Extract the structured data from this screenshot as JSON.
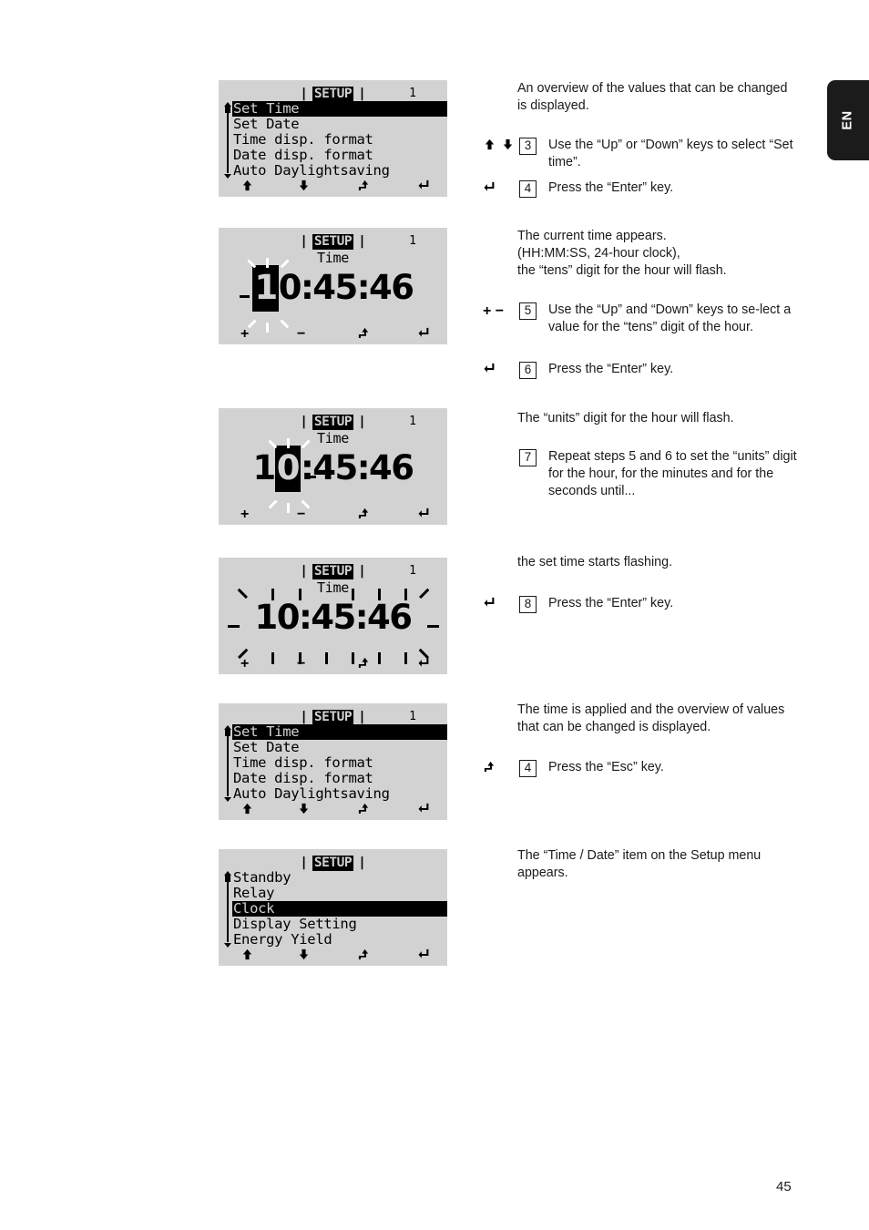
{
  "page": {
    "number": "45",
    "language_tab": "EN"
  },
  "icons": {
    "up": "▲",
    "down": "▼",
    "esc": "⬑",
    "enter": "↵",
    "plus": "+",
    "minus": "−"
  },
  "steps": [
    {
      "lcd": {
        "type": "menu",
        "header_left_pipe": "|",
        "header_title": "SETUP",
        "header_right_pipe": "|",
        "header_number": "1",
        "items": [
          "Set Time",
          "Set Date",
          "Time disp. format",
          "Date disp. format",
          "Auto Daylightsaving"
        ],
        "selected_index": 0,
        "softkeys": [
          "up",
          "down",
          "esc",
          "enter"
        ]
      },
      "paragraph": "An overview of the values that can be changed is displayed.",
      "instructions": [
        {
          "key_icon": "up-down",
          "number": "3",
          "text": "Use the “Up” or “Down” keys to select “Set time”."
        },
        {
          "key_icon": "enter",
          "number": "4",
          "text": "Press the “Enter” key."
        }
      ]
    },
    {
      "lcd": {
        "type": "time",
        "header_left_pipe": "|",
        "header_title": "SETUP",
        "header_right_pipe": "|",
        "header_number": "1",
        "subtitle": "Time",
        "time_digits": [
          "1",
          "0",
          ":",
          "4",
          "5",
          ":",
          "4",
          "6"
        ],
        "highlight_index": 0,
        "flash_scope": "digit",
        "softkeys": [
          "plus",
          "minus",
          "esc",
          "enter"
        ]
      },
      "paragraph": "The current time appears.\n(HH:MM:SS, 24-hour clock),\nthe “tens” digit for the hour will flash.",
      "instructions": [
        {
          "key_icon": "plus-minus",
          "number": "5",
          "text": "Use the “Up” and “Down” keys to se-lect a value for the “tens” digit of the hour."
        },
        {
          "key_icon": "enter",
          "number": "6",
          "text": "Press the “Enter” key."
        }
      ]
    },
    {
      "lcd": {
        "type": "time",
        "header_left_pipe": "|",
        "header_title": "SETUP",
        "header_right_pipe": "|",
        "header_number": "1",
        "subtitle": "Time",
        "time_digits": [
          "1",
          "0",
          ":",
          "4",
          "5",
          ":",
          "4",
          "6"
        ],
        "highlight_index": 1,
        "flash_scope": "digit",
        "softkeys": [
          "plus",
          "minus",
          "esc",
          "enter"
        ]
      },
      "paragraph": "The “units” digit for the hour will flash.",
      "instructions": [
        {
          "key_icon": "none",
          "number": "7",
          "text": "Repeat steps 5 and 6 to set the “units” digit for the hour, for the minutes and for the seconds until..."
        }
      ]
    },
    {
      "lcd": {
        "type": "time",
        "header_left_pipe": "|",
        "header_title": "SETUP",
        "header_right_pipe": "|",
        "header_number": "1",
        "subtitle": "Time",
        "time_digits": [
          "1",
          "0",
          ":",
          "4",
          "5",
          ":",
          "4",
          "6"
        ],
        "highlight_index": -1,
        "flash_scope": "all",
        "softkeys": [
          "plus",
          "minus",
          "esc",
          "enter"
        ]
      },
      "paragraph": "the set time starts flashing.",
      "instructions": [
        {
          "key_icon": "enter",
          "number": "8",
          "text": "Press the “Enter” key."
        }
      ]
    },
    {
      "lcd": {
        "type": "menu",
        "header_left_pipe": "|",
        "header_title": "SETUP",
        "header_right_pipe": "|",
        "header_number": "1",
        "items": [
          "Set Time",
          "Set Date",
          "Time disp. format",
          "Date disp. format",
          "Auto Daylightsaving"
        ],
        "selected_index": 0,
        "softkeys": [
          "up",
          "down",
          "esc",
          "enter"
        ]
      },
      "paragraph": "The time is applied and the overview of values that can be changed is displayed.",
      "instructions": [
        {
          "key_icon": "esc",
          "number": "4",
          "text": "Press the “Esc” key."
        }
      ]
    },
    {
      "lcd": {
        "type": "menu",
        "header_left_pipe": "|",
        "header_title": "SETUP",
        "header_right_pipe": "|",
        "header_number": "",
        "items": [
          "Standby",
          "Relay",
          "Clock",
          "Display Setting",
          "Energy Yield"
        ],
        "selected_index": 2,
        "softkeys": [
          "up",
          "down",
          "esc",
          "enter"
        ]
      },
      "paragraph": "The “Time / Date” item on the Setup menu appears.",
      "instructions": []
    }
  ]
}
